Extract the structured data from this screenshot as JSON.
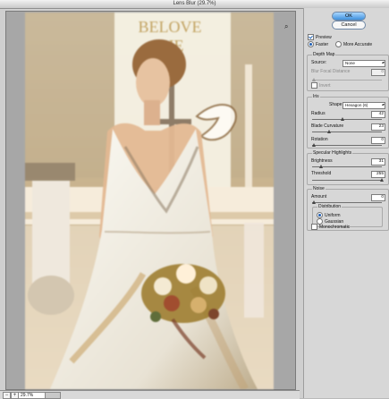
{
  "window": {
    "title": "Lens Blur (29.7%)"
  },
  "preview": {
    "zoom": "29.7%"
  },
  "buttons": {
    "ok": "OK",
    "cancel": "Cancel"
  },
  "options": {
    "preview": "Preview",
    "faster": "Faster",
    "more_accurate": "More Accurate"
  },
  "depth_map": {
    "title": "Depth Map",
    "source_label": "Source:",
    "source_value": "None",
    "blur_focal_label": "Blur Focal Distance",
    "blur_focal_value": "0",
    "invert": "Invert"
  },
  "iris": {
    "title": "Iris",
    "shape_label": "Shape:",
    "shape_value": "Hexagon (6)",
    "radius_label": "Radius",
    "radius_value": "42",
    "blade_label": "Blade Curvature",
    "blade_value": "23",
    "rotation_label": "Rotation",
    "rotation_value": "0"
  },
  "specular": {
    "title": "Specular Highlights",
    "brightness_label": "Brightness",
    "brightness_value": "31",
    "threshold_label": "Threshold",
    "threshold_value": "255"
  },
  "noise": {
    "title": "Noise",
    "amount_label": "Amount",
    "amount_value": "0",
    "distribution_title": "Distribution",
    "uniform": "Uniform",
    "gaussian": "Gaussian",
    "monochromatic": "Monochromatic"
  }
}
